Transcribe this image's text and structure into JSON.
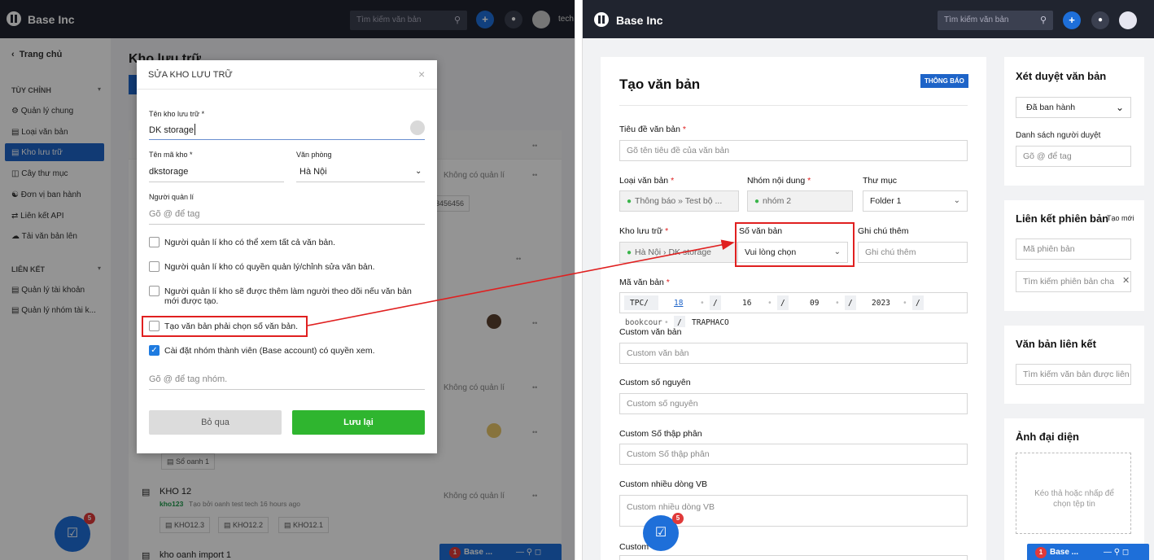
{
  "left": {
    "brand": "Base Inc",
    "search_placeholder": "Tìm kiếm văn bản",
    "user_short": "tech",
    "sidebar": {
      "home": "Trang chủ",
      "section1": "TÙY CHỈNH",
      "items1": [
        "Quản lý chung",
        "Loại văn bản",
        "Kho lưu trữ",
        "Cây thư mục",
        "Đơn vị ban hành",
        "Liên kết API",
        "Tải văn bản lên"
      ],
      "section2": "LIÊN KẾT",
      "items2": [
        "Quản lý tài khoản",
        "Quản lý nhóm tài k..."
      ]
    },
    "page_title": "Kho lưu trữ",
    "no_manager": "Không có quản lí",
    "phone": "3456456",
    "chip_so_oanh": "Sổ oanh 1",
    "kho12": {
      "name": "KHO 12",
      "code": "kho123",
      "meta": "Tạo bởi oanh test tech 16 hours ago",
      "chips": [
        "KHO12.3",
        "KHO12.2",
        "KHO12.1"
      ]
    },
    "kho_import": "kho oanh import 1",
    "fab_badge": "5",
    "mini_bar": "Base ...",
    "mini_badge": "1"
  },
  "modal": {
    "title": "SỬA KHO LƯU TRỮ",
    "close": "×",
    "name_label": "Tên kho lưu trữ *",
    "name_value": "DK storage",
    "code_label": "Tên mã kho *",
    "code_value": "dkstorage",
    "office_label": "Văn phòng",
    "office_value": "Hà Nội",
    "manager_label": "Người quản lí",
    "manager_placeholder": "Gõ @ để tag",
    "checks": [
      {
        "label": "Người quản lí kho có thể xem tất cả văn bản.",
        "checked": false
      },
      {
        "label": "Người quản lí kho có quyền quản lý/chỉnh sửa văn bản.",
        "checked": false
      },
      {
        "label": "Người quản lí kho sẽ được thêm làm người theo dõi nếu văn bản mới được tạo.",
        "checked": false
      },
      {
        "label": "Tạo văn bản phải chọn số văn bản.",
        "checked": false
      },
      {
        "label": "Cài đặt nhóm thành viên (Base account) có quyền xem.",
        "checked": true
      }
    ],
    "group_placeholder": "Gõ @ để tag nhóm.",
    "cancel": "Bỏ qua",
    "save": "Lưu lại"
  },
  "right": {
    "brand": "Base Inc",
    "search_placeholder": "Tìm kiếm văn bản",
    "title": "Tạo văn bản",
    "badge": "THÔNG BÁO",
    "doc_title_label": "Tiêu đề văn bản",
    "doc_title_placeholder": "Gõ tên tiêu đề của văn bản",
    "type_label": "Loại văn bản",
    "type_value": "Thông báo » Test bộ ...",
    "group_label": "Nhóm nội dung",
    "group_value": "nhóm 2",
    "folder_label": "Thư mục",
    "folder_value": "Folder 1",
    "storage_label": "Kho lưu trữ",
    "storage_value": "Hà Nội › DK storage",
    "number_label": "Số văn bản",
    "number_value": "Vui lòng chọn",
    "note_label": "Ghi chú thêm",
    "note_placeholder": "Ghi chú thêm",
    "code_label": "Mã văn bản",
    "code_parts": [
      "TPC/",
      "18",
      "/",
      "16",
      "/",
      "09",
      "/",
      "2023",
      "/"
    ],
    "code_line2": [
      "bookcour",
      "/",
      "TRAPHACO"
    ],
    "fields": [
      {
        "label": "Custom văn bản",
        "placeholder": "Custom văn bản"
      },
      {
        "label": "Custom số nguyên",
        "placeholder": "Custom số nguyên"
      },
      {
        "label": "Custom Số thập phân",
        "placeholder": "Custom Số thập phân"
      },
      {
        "label": "Custom nhiều dòng VB",
        "placeholder": "Custom nhiều dòng VB"
      }
    ],
    "last_label": "Custom",
    "approve": {
      "title": "Xét duyệt văn bản",
      "status": "Đã ban hành",
      "approvers_label": "Danh sách người duyệt",
      "approvers_placeholder": "Gõ @ để tag"
    },
    "version_link": {
      "title": "Liên kết phiên bản",
      "new": "Tạo mới",
      "code_placeholder": "Mã phiên bản",
      "search_placeholder": "Tìm kiếm phiên bản cha"
    },
    "linked": {
      "title": "Văn bản liên kết",
      "placeholder": "Tìm kiếm văn bản được liên"
    },
    "avatar": {
      "title": "Ảnh đại diện",
      "drop": "Kéo thả hoặc nhấp để chọn tệp tin"
    },
    "fab_badge": "5",
    "mini_bar": "Base ...",
    "mini_badge": "1"
  }
}
